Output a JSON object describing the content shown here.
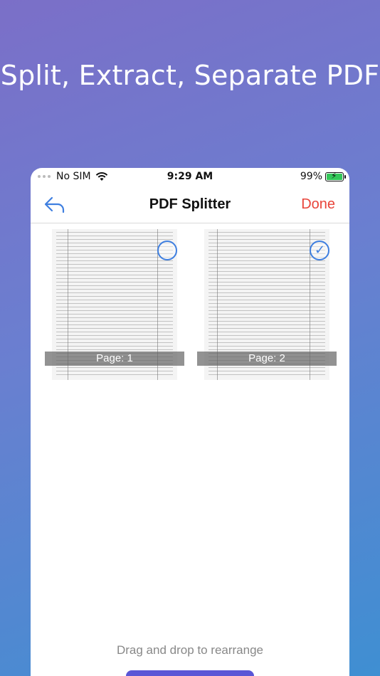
{
  "headline": "Split, Extract, Separate PDF",
  "status": {
    "carrier": "No SIM",
    "time": "9:29 AM",
    "battery": "99%"
  },
  "nav": {
    "title": "PDF Splitter",
    "done_label": "Done"
  },
  "pages": [
    {
      "label": "Page: 1",
      "selected": false
    },
    {
      "label": "Page: 2",
      "selected": true
    }
  ],
  "hint": "Drag and drop to rearrange",
  "colors": {
    "accent": "#3f7fe0",
    "done": "#e8443a",
    "button": "#5a56d6"
  },
  "icons": {
    "back": "back-arrow-icon",
    "wifi": "wifi-icon",
    "battery": "battery-charging-icon",
    "check": "checkmark-icon"
  }
}
